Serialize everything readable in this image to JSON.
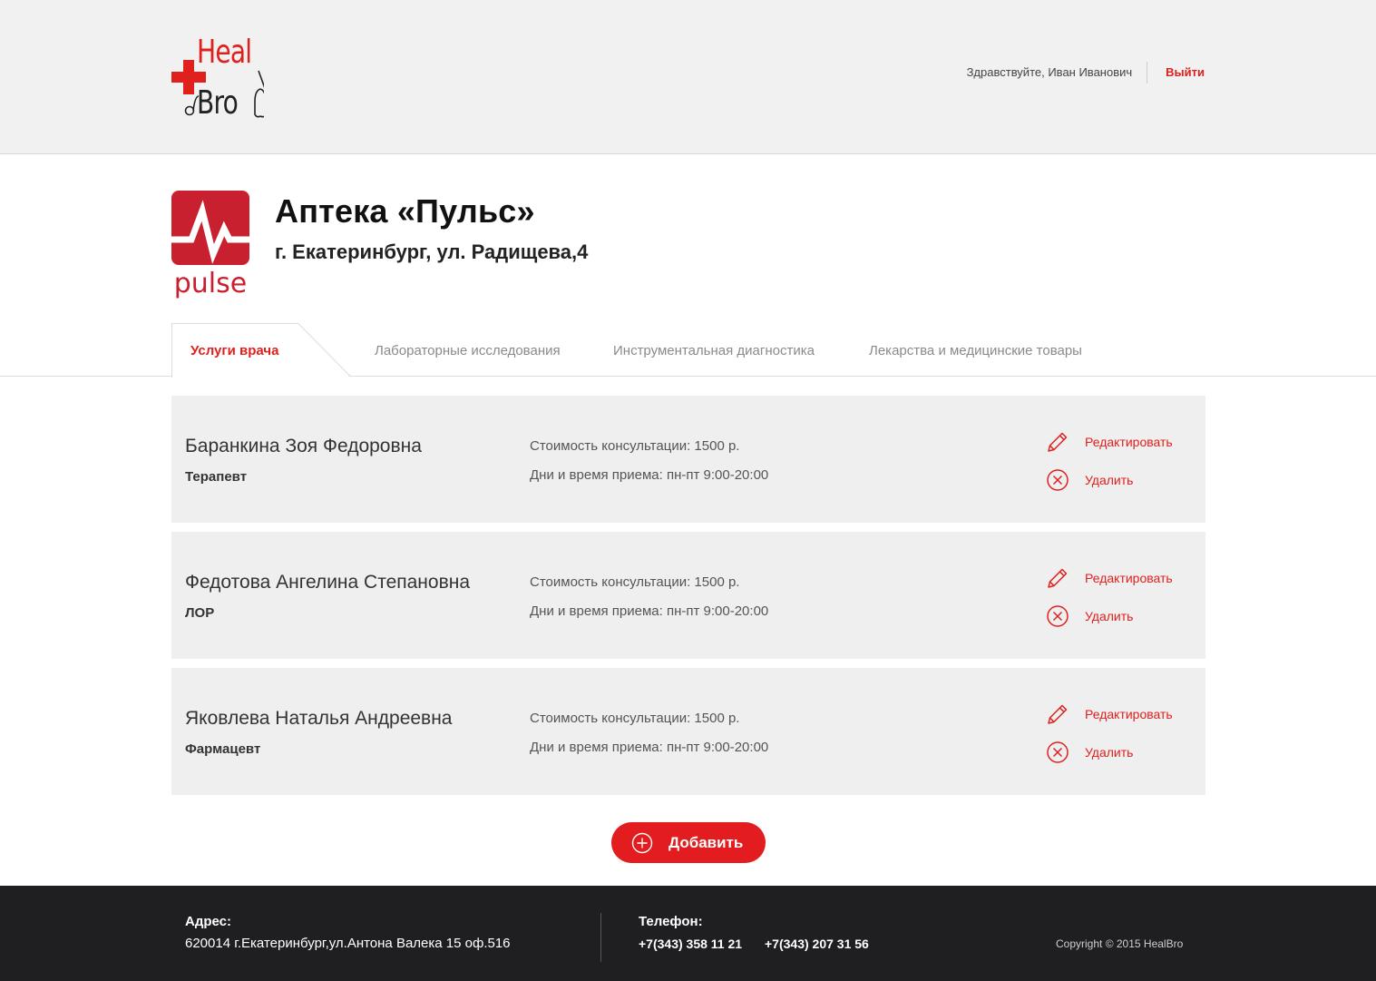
{
  "header": {
    "logo": {
      "line1": "Heal",
      "line2": "Bro"
    },
    "greeting": "Здравствуйте, Иван Иванович",
    "logout_label": "Выйти"
  },
  "pharmacy": {
    "logo_text": "pulse",
    "title": "Аптека «Пульс»",
    "address": "г. Екатеринбург, ул. Радищева,4"
  },
  "tabs": [
    {
      "label": "Услуги врача",
      "active": true
    },
    {
      "label": "Лабораторные исследования",
      "active": false
    },
    {
      "label": "Инструментальная диагностика",
      "active": false
    },
    {
      "label": "Лекарства и медицинские товары",
      "active": false
    }
  ],
  "doctors": [
    {
      "name": "Баранкина Зоя Федоровна",
      "specialty": "Терапевт",
      "price": "Стоимость консультации: 1500 р.",
      "hours": "Дни и время приема: пн-пт 9:00-20:00"
    },
    {
      "name": "Федотова Ангелина Степановна",
      "specialty": "ЛОР",
      "price": "Стоимость консультации: 1500 р.",
      "hours": "Дни и время приема: пн-пт 9:00-20:00"
    },
    {
      "name": "Яковлева Наталья Андреевна",
      "specialty": "Фармацевт",
      "price": "Стоимость консультации: 1500 р.",
      "hours": "Дни и время приема: пн-пт 9:00-20:00"
    }
  ],
  "actions": {
    "edit_label": "Редактировать",
    "delete_label": "Удалить",
    "edit_icon": "pencil-icon",
    "delete_icon": "close-circle-icon"
  },
  "add_button": {
    "label": "Добавить",
    "icon": "plus-circle-icon"
  },
  "footer": {
    "address_title": "Адрес:",
    "address": "620014 г.Екатеринбург,ул.Антона Валека 15 оф.516",
    "phone_title": "Телефон:",
    "phone1": "+7(343) 358 11 21",
    "phone2": "+7(343) 207 31 56",
    "copyright": "Copyright © 2015 HealBro"
  },
  "colors": {
    "accent": "#e0201d",
    "header_bg": "#f1f1f1",
    "card_bg": "#efefef",
    "footer_bg": "#1f1f21"
  }
}
